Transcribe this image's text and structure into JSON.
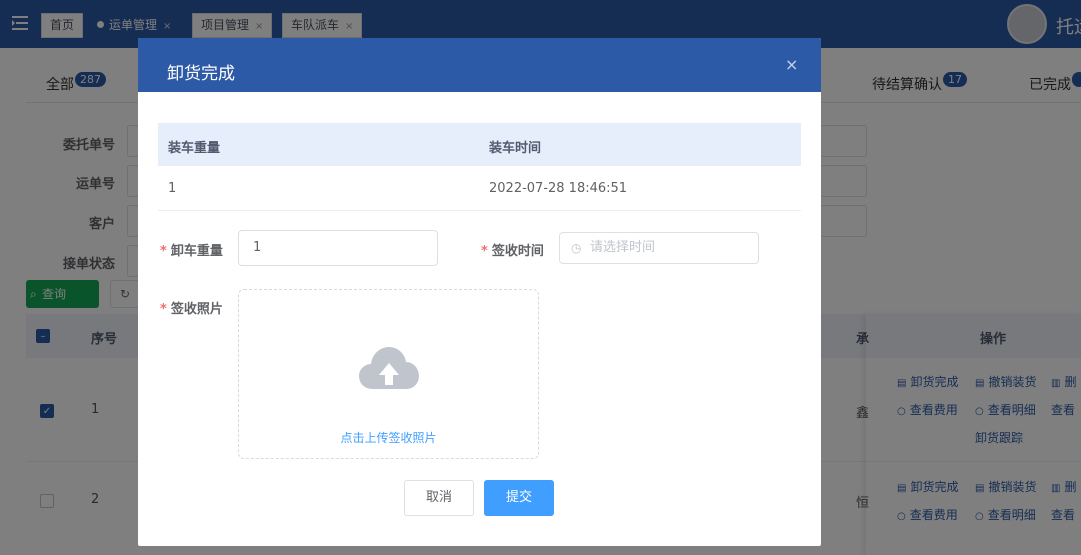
{
  "topbar": {
    "menu_icon": "fold-menu-icon",
    "tabs": [
      {
        "label": "首页",
        "active": false,
        "closable": false
      },
      {
        "label": "运单管理",
        "active": true,
        "closable": true
      },
      {
        "label": "项目管理",
        "active": false,
        "closable": true
      },
      {
        "label": "车队派车",
        "active": false,
        "closable": true
      }
    ],
    "close_glyph": "×",
    "username": "托运"
  },
  "status_tabs": [
    {
      "label": "全部",
      "count": "287"
    },
    {
      "label": "待结算确认",
      "count": "17"
    },
    {
      "label": "已完成",
      "count": ""
    }
  ],
  "search_form": {
    "labels": [
      "委托单号",
      "运单号",
      "客户",
      "接单状态"
    ],
    "query_button": "查询"
  },
  "grid": {
    "headers": {
      "seq": "序号",
      "carrier": "承",
      "actions": "操作"
    },
    "rows": [
      {
        "seq": "1",
        "checked": true,
        "carrier": "鑫",
        "actions": [
          "卸货完成",
          "撤销装货",
          "删",
          "查看费用",
          "查看明细",
          "查看",
          "卸货跟踪"
        ]
      },
      {
        "seq": "2",
        "checked": false,
        "carrier": "恒",
        "actions": [
          "卸货完成",
          "撤销装货",
          "删",
          "查看费用",
          "查看明细",
          "查看"
        ]
      }
    ]
  },
  "dialog": {
    "title": "卸货完成",
    "close_glyph": "×",
    "table": {
      "headers": [
        "装车重量",
        "装车时间"
      ],
      "row": [
        "1",
        "2022-07-28 18:46:51"
      ]
    },
    "fields": {
      "unload_weight_label": "卸车重量",
      "unload_weight_value": "1",
      "sign_time_label": "签收时间",
      "sign_time_placeholder": "请选择时间",
      "sign_photo_label": "签收照片",
      "required_mark": "*"
    },
    "upload": {
      "text": "点击上传签收照片",
      "icon": "cloud-upload-icon"
    },
    "buttons": {
      "cancel": "取消",
      "submit": "提交"
    }
  },
  "colors": {
    "primary": "#2d5aa6",
    "accent_blue": "#409eff",
    "query_green": "#13a854",
    "required_red": "#f56c6c"
  }
}
